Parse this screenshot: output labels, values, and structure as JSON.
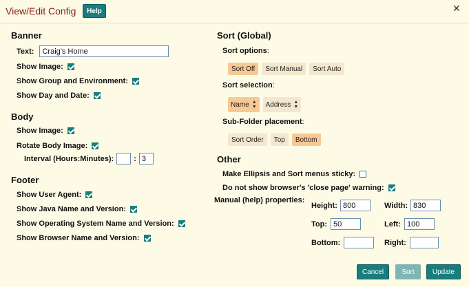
{
  "window": {
    "title": "View/Edit Config",
    "help_label": "Help",
    "close_glyph": "✕"
  },
  "banner": {
    "heading": "Banner",
    "text_label": "Text:",
    "text_value": "Craig's Home",
    "show_image_label": "Show Image:",
    "show_group_label": "Show Group and Environment:",
    "show_day_label": "Show Day and Date:"
  },
  "body_section": {
    "heading": "Body",
    "show_image_label": "Show Image:",
    "rotate_label": "Rotate Body Image:",
    "interval_label": "Interval (Hours:Minutes):",
    "interval_hours": "",
    "interval_sep": ":",
    "interval_minutes": "3"
  },
  "footer": {
    "heading": "Footer",
    "user_agent_label": "Show User Agent:",
    "java_label": "Show Java Name and Version:",
    "os_label": "Show Operating System Name and Version:",
    "browser_label": "Show Browser Name and Version:"
  },
  "sort": {
    "heading": "Sort (Global)",
    "options_label": "Sort options",
    "options": [
      "Sort Off",
      "Sort Manual",
      "Sort Auto"
    ],
    "options_selected": "Sort Off",
    "selection_label": "Sort selection",
    "selection": [
      "Name",
      "Address"
    ],
    "selection_selected": "Name",
    "subfolder_label": "Sub-Folder placement",
    "subfolder": [
      "Sort Order",
      "Top",
      "Bottom"
    ],
    "subfolder_selected": "Bottom",
    "colon": ":"
  },
  "other": {
    "heading": "Other",
    "ellipsis_label": "Make Ellipsis and Sort menus sticky:",
    "warning_label": "Do not show browser's 'close page' warning:",
    "manual_label": "Manual (help) properties:",
    "height_label": "Height:",
    "height_value": "800",
    "width_label": "Width:",
    "width_value": "830",
    "top_label": "Top:",
    "top_value": "50",
    "left_label": "Left:",
    "left_value": "100",
    "bottom_label": "Bottom:",
    "bottom_value": "",
    "right_label": "Right:",
    "right_value": ""
  },
  "actions": {
    "cancel_label": "Cancel",
    "sort_label": "Sort",
    "update_label": "Update"
  },
  "checkboxes": {
    "banner_show_image": true,
    "banner_show_group": true,
    "banner_show_day": true,
    "body_show_image": true,
    "body_rotate": true,
    "footer_user_agent": true,
    "footer_java": true,
    "footer_os": true,
    "footer_browser": true,
    "other_ellipsis": false,
    "other_warning": true
  },
  "colors": {
    "background": "#fdfbe6",
    "title": "#8b1a1a",
    "accent": "#1a7d7d",
    "chip": "#f3e8cf",
    "chip_active": "#f8c994"
  },
  "icons": {
    "close": "close-icon",
    "checkbox": "checkbox-icon",
    "sort": "sort-arrows-icon"
  }
}
